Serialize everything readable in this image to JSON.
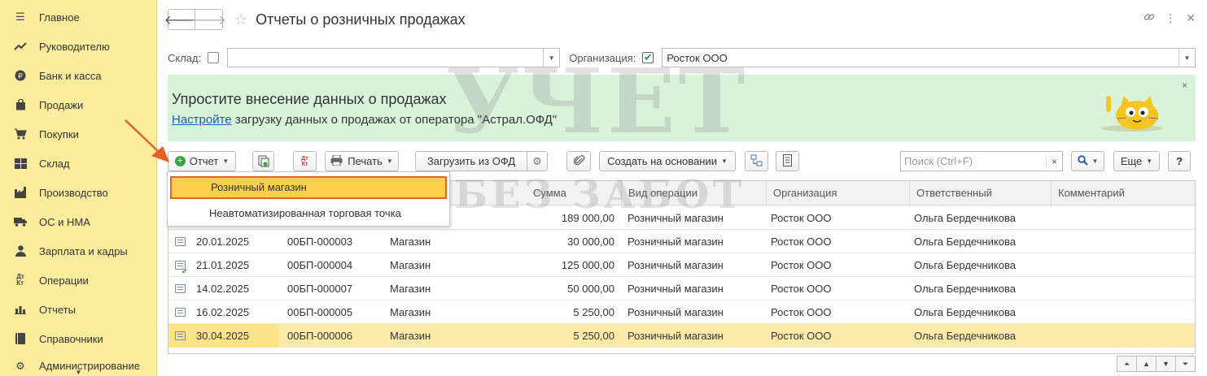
{
  "sidebar": {
    "items": [
      {
        "label": "Главное",
        "icon": "menu-icon"
      },
      {
        "label": "Руководителю",
        "icon": "trend-icon"
      },
      {
        "label": "Банк и касса",
        "icon": "ruble-coin-icon"
      },
      {
        "label": "Продажи",
        "icon": "shopping-bag-icon"
      },
      {
        "label": "Покупки",
        "icon": "cart-icon"
      },
      {
        "label": "Склад",
        "icon": "warehouse-icon"
      },
      {
        "label": "Производство",
        "icon": "factory-icon"
      },
      {
        "label": "ОС и НМА",
        "icon": "truck-icon"
      },
      {
        "label": "Зарплата и кадры",
        "icon": "person-icon"
      },
      {
        "label": "Операции",
        "icon": "dt-kt-icon"
      },
      {
        "label": "Отчеты",
        "icon": "bar-chart-icon"
      },
      {
        "label": "Справочники",
        "icon": "book-icon"
      },
      {
        "label": "Администрирование",
        "icon": "gear-icon"
      }
    ]
  },
  "header": {
    "title": "Отчеты о розничных продажах"
  },
  "filters": {
    "warehouse_label": "Склад:",
    "warehouse_value": "",
    "org_label": "Организация:",
    "org_value": "Росток ООО",
    "org_checked": "✔"
  },
  "promo": {
    "title": "Упростите внесение данных о продажах",
    "link": "Настройте",
    "text": " загрузку данных о продажах от оператора \"Астрал.ОФД\"",
    "close": "×"
  },
  "toolbar": {
    "report": "Отчет",
    "print": "Печать",
    "load_ofd": "Загрузить из ОФД",
    "create_based": "Создать на основании",
    "search_placeholder": "Поиск (Ctrl+F)",
    "search_clear": "×",
    "more": "Еще",
    "help": "?",
    "dtkt": "Дт Кт"
  },
  "menu": {
    "items": [
      "Розничный магазин",
      "Неавтоматизированная торговая точка"
    ]
  },
  "table": {
    "columns": [
      "Сумма",
      "Вид операции",
      "Организация",
      "Ответственный",
      "Комментарий"
    ],
    "rows": [
      {
        "date": "",
        "number": "",
        "warehouse": "",
        "sum": "189 000,00",
        "op": "Розничный магазин",
        "org": "Росток ООО",
        "resp": "Ольга Бердечникова",
        "comment": "",
        "posted": false
      },
      {
        "date": "20.01.2025",
        "number": "00БП-000003",
        "warehouse": "Магазин",
        "sum": "30 000,00",
        "op": "Розничный магазин",
        "org": "Росток ООО",
        "resp": "Ольга Бердечникова",
        "comment": "",
        "posted": false
      },
      {
        "date": "21.01.2025",
        "number": "00БП-000004",
        "warehouse": "Магазин",
        "sum": "125 000,00",
        "op": "Розничный магазин",
        "org": "Росток ООО",
        "resp": "Ольга Бердечникова",
        "comment": "",
        "posted": true
      },
      {
        "date": "14.02.2025",
        "number": "00БП-000007",
        "warehouse": "Магазин",
        "sum": "50 000,00",
        "op": "Розничный магазин",
        "org": "Росток ООО",
        "resp": "Ольга Бердечникова",
        "comment": "",
        "posted": false
      },
      {
        "date": "16.02.2025",
        "number": "00БП-000005",
        "warehouse": "Магазин",
        "sum": "5 250,00",
        "op": "Розничный магазин",
        "org": "Росток ООО",
        "resp": "Ольга Бердечникова",
        "comment": "",
        "posted": false
      },
      {
        "date": "30.04.2025",
        "number": "00БП-000006",
        "warehouse": "Магазин",
        "sum": "5 250,00",
        "op": "Розничный магазин",
        "org": "Росток ООО",
        "resp": "Ольга Бердечникова",
        "comment": "",
        "posted": false
      }
    ]
  },
  "watermark": {
    "line1": "УЧЕТ",
    "line2": "БЕЗ ЗАБОТ"
  },
  "colors": {
    "sidebar": "#fbec9e",
    "promo": "#d9f2da",
    "selection": "#fbeaa8",
    "menu_highlight": "#fcd04c",
    "menu_border": "#e4622a",
    "link": "#1f5aa6"
  }
}
